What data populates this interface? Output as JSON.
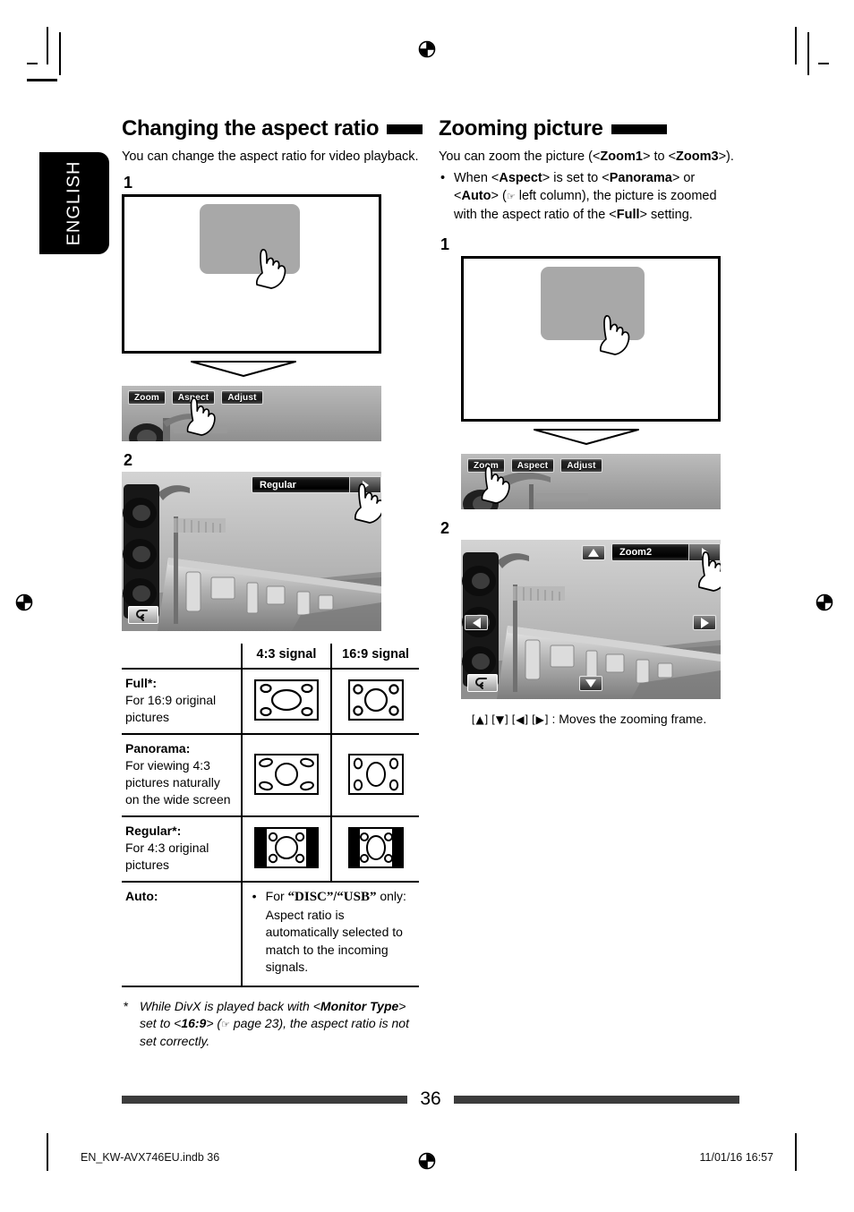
{
  "page": {
    "language_tab": "ENGLISH",
    "page_number": "36",
    "print_file": "EN_KW-AVX746EU.indb   36",
    "print_stamp": "11/01/16   16:57"
  },
  "left_column": {
    "title": "Changing the aspect ratio",
    "intro": "You can change the aspect ratio for video playback.",
    "step1_label": "1",
    "step2_label": "2",
    "osd_buttons": [
      "Zoom",
      "Aspect",
      "Adjust"
    ],
    "osd_selected_button": "Aspect",
    "osd_bar_label": "Regular",
    "table": {
      "headers": [
        "",
        "4:3 signal",
        "16:9 signal"
      ],
      "rows": [
        {
          "name": "Full*:",
          "desc": "For 16:9 original pictures",
          "icon_43": "full-4-3-diagram",
          "icon_169": "full-16-9-diagram"
        },
        {
          "name": "Panorama:",
          "desc": "For viewing 4:3 pictures naturally on the wide screen",
          "icon_43": "panorama-4-3-diagram",
          "icon_169": "panorama-16-9-diagram"
        },
        {
          "name": "Regular*:",
          "desc": "For 4:3 original pictures",
          "icon_43": "regular-4-3-diagram",
          "icon_169": "regular-16-9-diagram"
        }
      ],
      "auto_row": {
        "name": "Auto:",
        "note_prefix": "For ",
        "note_disc": "“DISC”",
        "note_sep": "/",
        "note_usb": "“USB”",
        "note_rest": " only: Aspect ratio is automatically selected to match to the incoming signals."
      }
    },
    "footnote": {
      "star": "*",
      "part1": "While DivX is played back with <",
      "bold1": "Monitor Type",
      "part2": "> set to <",
      "bold2": "16:9",
      "part3": "> (",
      "hand": "☞",
      "part4": " page 23), the aspect ratio is not set correctly."
    }
  },
  "right_column": {
    "title": "Zooming picture",
    "intro": {
      "part1": "You can zoom the picture (<",
      "bold1": "Zoom1",
      "part2": "> to <",
      "bold2": "Zoom3",
      "part3": ">)."
    },
    "bullet": {
      "part1": "When <",
      "bold1": "Aspect",
      "part2": "> is set to <",
      "bold2": "Panorama",
      "part3": "> or <",
      "bold3": "Auto",
      "part4": "> (",
      "hand": "☞",
      "part5": " left column), the picture is zoomed with the aspect ratio of the <",
      "bold4": "Full",
      "part6": "> setting."
    },
    "step1_label": "1",
    "step2_label": "2",
    "osd_buttons": [
      "Zoom",
      "Aspect",
      "Adjust"
    ],
    "osd_selected_button": "Zoom",
    "osd_bar_label": "Zoom2",
    "caption": {
      "keys": "[▲] [▼] [◀] [▶]",
      "text": " : Moves the zooming frame."
    }
  },
  "colors": {
    "ink": "#000000",
    "panel_gray": "#a8a8a8",
    "footer_bar": "#3c3c3c"
  }
}
